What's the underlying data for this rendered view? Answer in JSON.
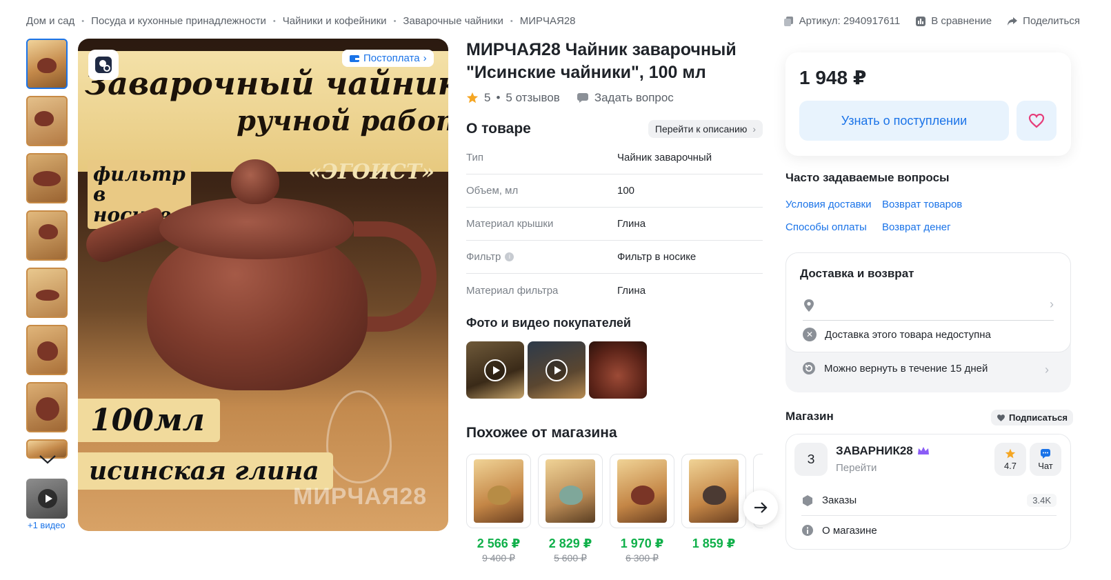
{
  "breadcrumb": [
    "Дом и сад",
    "Посуда и кухонные принадлежности",
    "Чайники и кофейники",
    "Заварочные чайники",
    "МИРЧАЯ28"
  ],
  "toplinks": {
    "article": "Артикул: 2940917611",
    "compare": "В сравнение",
    "share": "Поделиться"
  },
  "gallery": {
    "badge": "Постоплата",
    "video_label": "+1 видео",
    "image_text": {
      "line1": "Заварочный чайник",
      "line2": "ручной работы",
      "filter": "фильтр в носике",
      "egoist": "«ЭГОИСТ»",
      "volume": "100мл",
      "clay": "исинская глина",
      "watermark": "МИРЧАЯ28"
    }
  },
  "product": {
    "title": "МИРЧАЯ28 Чайник заварочный \"Исинские чайники\", 100 мл",
    "rating": "5",
    "reviews": "5 отзывов",
    "ask": "Задать вопрос"
  },
  "about": {
    "heading": "О товаре",
    "to_desc": "Перейти к описанию",
    "specs": [
      {
        "k": "Тип",
        "v": "Чайник заварочный"
      },
      {
        "k": "Объем, мл",
        "v": "100"
      },
      {
        "k": "Материал крышки",
        "v": "Глина"
      },
      {
        "k": "Фильтр",
        "v": "Фильтр в носике"
      },
      {
        "k": "Материал фильтра",
        "v": "Глина"
      }
    ]
  },
  "photos_heading": "Фото и видео покупателей",
  "similar": {
    "heading": "Похожее от магазина",
    "items": [
      {
        "price": "2 566 ₽",
        "old": "9 400 ₽"
      },
      {
        "price": "2 829 ₽",
        "old": "5 600 ₽"
      },
      {
        "price": "1 970 ₽",
        "old": "6 300 ₽"
      },
      {
        "price": "1 859 ₽",
        "old": ""
      }
    ]
  },
  "buy": {
    "price": "1 948 ₽",
    "notify": "Узнать о поступлении"
  },
  "faq": {
    "heading": "Часто задаваемые вопросы",
    "links": [
      "Условия доставки",
      "Возврат товаров",
      "Способы оплаты",
      "Возврат денег"
    ]
  },
  "delivery": {
    "heading": "Доставка и возврат",
    "unavailable": "Доставка этого товара недоступна",
    "return": "Можно вернуть в течение 15 дней"
  },
  "shop": {
    "heading": "Магазин",
    "subscribe": "Подписаться",
    "avatar": "З",
    "name": "ЗАВАРНИК28",
    "go": "Перейти",
    "rating": "4.7",
    "chat": "Чат",
    "orders_label": "Заказы",
    "orders_count": "3.4K",
    "about": "О магазине"
  },
  "colors": {
    "accent": "#1a73e8",
    "price_green": "#10b04a",
    "heart": "#e63d7a",
    "star": "#f5a623"
  }
}
